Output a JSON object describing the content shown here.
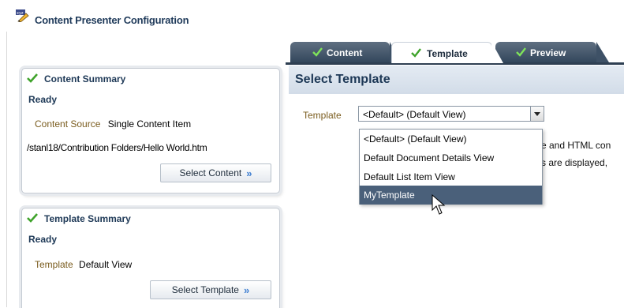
{
  "app": {
    "title": "Content Presenter Configuration",
    "icon": "xyz-pencil-icon"
  },
  "tabs": [
    {
      "label": "Content",
      "icon": "check-icon",
      "active": false
    },
    {
      "label": "Template",
      "icon": "check-icon",
      "active": true
    },
    {
      "label": "Preview",
      "icon": "check-icon",
      "active": false
    }
  ],
  "content_summary": {
    "title": "Content Summary",
    "status": "Ready",
    "source_label": "Content Source",
    "source_value": "Single Content Item",
    "path": "/stanl18/Contribution Folders/Hello World.htm",
    "button_label": "Select Content"
  },
  "template_summary": {
    "title": "Template Summary",
    "status": "Ready",
    "template_label": "Template",
    "template_value": "Default View",
    "button_label": "Select Template"
  },
  "main": {
    "title": "Select Template",
    "template_field_label": "Template",
    "template_selected": "<Default> (Default View)",
    "obscured_line1": "e and HTML con",
    "obscured_line2": "s are displayed,",
    "options": [
      "<Default> (Default View)",
      "Default Document Details View",
      "Default List Item View",
      "MyTemplate"
    ],
    "highlighted_option": "MyTemplate"
  },
  "colors": {
    "accent_check": "#3fa32b",
    "tab_dark": "#33475c",
    "header_blue": "#1d3856",
    "label_gold": "#7a5c1e",
    "selection": "#4a607a"
  }
}
